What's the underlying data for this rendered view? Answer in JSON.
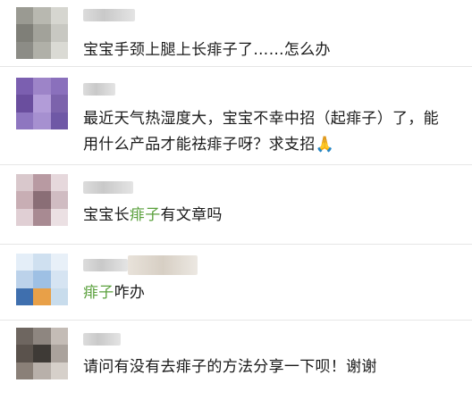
{
  "comments": [
    {
      "text": "宝宝手颈上腿上长痱子了……怎么办",
      "avatar_colors": [
        "#9a9a92",
        "#b8b8b0",
        "#d6d6d0",
        "#7f7f78",
        "#a2a29a",
        "#c8c8c2",
        "#8c8c86",
        "#b0b0a8",
        "#dadad4"
      ]
    },
    {
      "line1": "最近天气热湿度大，宝宝不幸中招（起痱子）了，能",
      "line2": "用什么产品才能祛痱子呀？求支招",
      "emoji": "🙏",
      "avatar_colors": [
        "#7b5fb0",
        "#9d84c8",
        "#8a70bc",
        "#6a4e9e",
        "#b29cd8",
        "#7c63ac",
        "#8e76c0",
        "#a690d0",
        "#6f58a6"
      ]
    },
    {
      "before": "宝宝长",
      "highlight": "痱子",
      "after": "有文章吗",
      "avatar_colors": [
        "#d9c8cc",
        "#b89aa2",
        "#e6d8dc",
        "#c8aeb4",
        "#8a6e76",
        "#d0bcc2",
        "#e0cfd4",
        "#a88a92",
        "#ebe0e3"
      ]
    },
    {
      "highlight": "痱子",
      "after": "咋办",
      "avatar_colors": [
        "#e4eef8",
        "#cfe0f0",
        "#e8f0f8",
        "#bcd2ea",
        "#9ec0e4",
        "#d6e4f2",
        "#3f6fae",
        "#e8a048",
        "#c8dcec"
      ]
    },
    {
      "text": "请问有没有去痱子的方法分享一下呗！谢谢",
      "avatar_colors": [
        "#6e6660",
        "#8e8680",
        "#c4bcb6",
        "#5a524c",
        "#3e3a36",
        "#aaa29c",
        "#8a8078",
        "#b8b0aa",
        "#d6d0ca"
      ]
    }
  ]
}
